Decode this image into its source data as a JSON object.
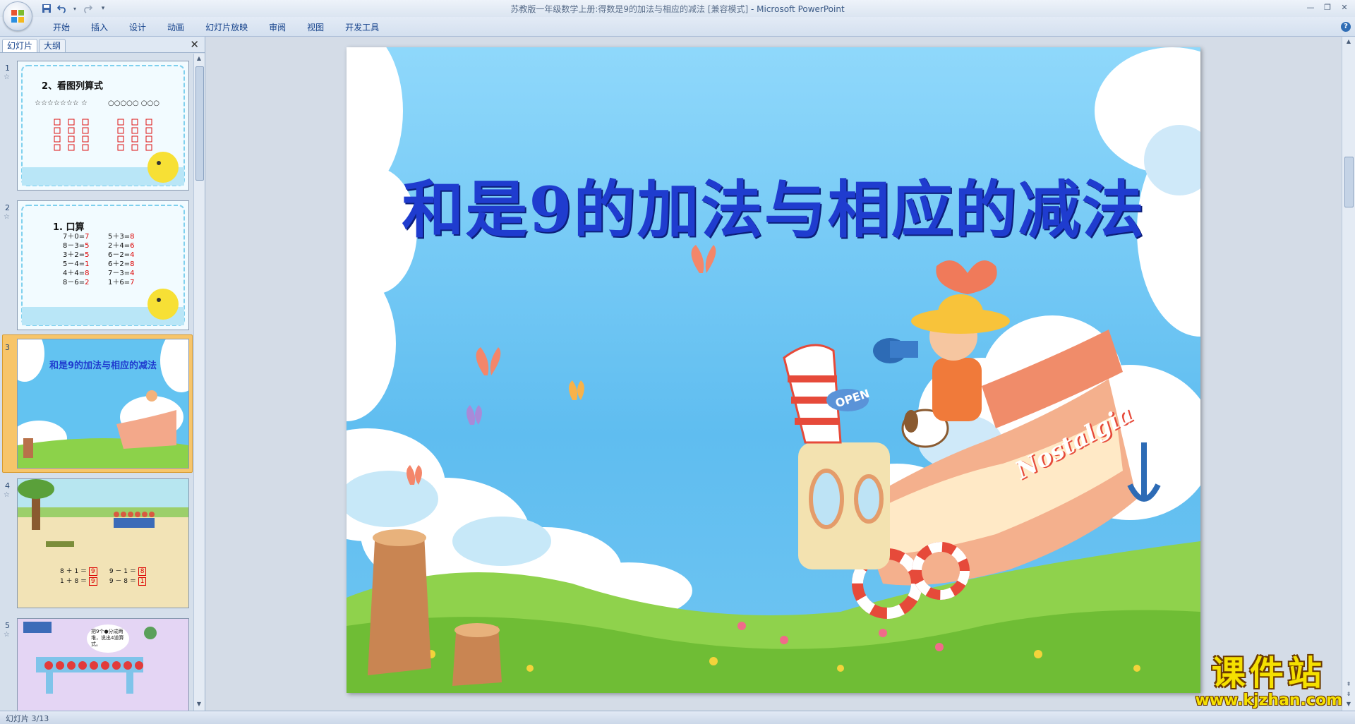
{
  "window": {
    "title": "苏教版一年级数学上册:得数是9的加法与相应的减法 [兼容模式]",
    "app_suffix": " - Microsoft PowerPoint"
  },
  "ribbon": {
    "tabs": [
      "开始",
      "插入",
      "设计",
      "动画",
      "幻灯片放映",
      "审阅",
      "视图",
      "开发工具"
    ]
  },
  "pane": {
    "tab_slides": "幻灯片",
    "tab_outline": "大纲"
  },
  "thumbnails": [
    {
      "number": "1",
      "title": "2、看图列算式",
      "stars": "☆☆☆☆☆☆☆ ☆",
      "circles": "○○○○○ ○○○"
    },
    {
      "number": "2",
      "title": "1. 口算",
      "left_col": [
        "7＋0=",
        "8－3=",
        "3＋2=",
        "5－4=",
        "4＋4=",
        "8－6="
      ],
      "left_ans": [
        "7",
        "5",
        "5",
        "1",
        "8",
        "2"
      ],
      "right_col": [
        "5＋3=",
        "2＋4=",
        "6－2=",
        "6＋2=",
        "7－3=",
        "1＋6="
      ],
      "right_ans": [
        "8",
        "6",
        "4",
        "8",
        "4",
        "7"
      ]
    },
    {
      "number": "3",
      "title": "和是9的加法与相应的减法"
    },
    {
      "number": "4",
      "eq": [
        "8 ＋ 1 ＝",
        "9 － 1 ＝",
        "1 ＋ 8 ＝",
        "9 － 8 ＝"
      ],
      "ans": [
        "9",
        "8",
        "9",
        "1"
      ]
    },
    {
      "number": "5",
      "bubble": "把9个●分成两堆，说出4道算式。"
    }
  ],
  "slide": {
    "title": "和是9的加法与相应的减法",
    "open_sign": "OPEN",
    "boat_text": "Nostalgia"
  },
  "status": {
    "slide_info": "幻灯片 3/13"
  },
  "watermark": {
    "text": "课件站",
    "url": "www.kjzhan.com"
  },
  "colors": {
    "title_blue": "#1f3ccf",
    "sky": "#6ec8f5",
    "grass": "#8cd24a",
    "selection": "#f7c56a"
  }
}
